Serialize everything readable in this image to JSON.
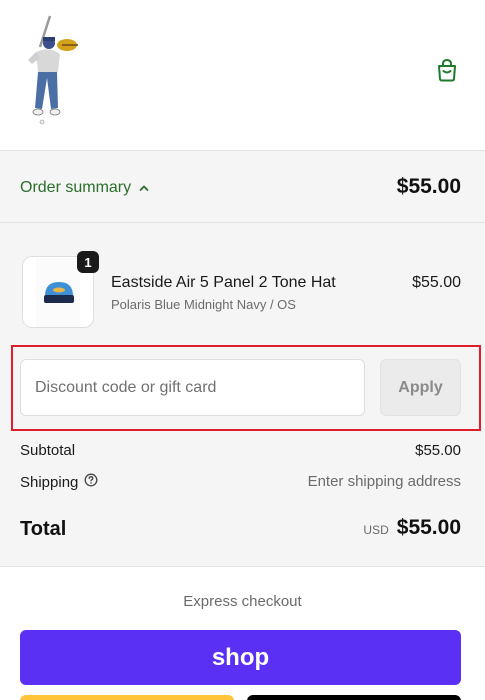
{
  "header": {
    "logo_icon": "golfer-logo-icon",
    "cart_icon": "shopping-bag-icon"
  },
  "order_summary": {
    "toggle_label": "Order summary",
    "toggle_icon": "chevron-up-icon",
    "total": "$55.00"
  },
  "line_item": {
    "quantity": "1",
    "name": "Eastside Air 5 Panel 2 Tone Hat",
    "variant": "Polaris Blue Midnight Navy / OS",
    "price": "$55.00"
  },
  "discount": {
    "placeholder": "Discount code or gift card",
    "value": "",
    "apply_label": "Apply"
  },
  "totals": {
    "subtotal_label": "Subtotal",
    "subtotal_value": "$55.00",
    "shipping_label": "Shipping",
    "shipping_icon": "help-circle-icon",
    "shipping_value": "Enter shipping address",
    "total_label": "Total",
    "currency": "USD",
    "total_value": "$55.00"
  },
  "express": {
    "label": "Express checkout",
    "shop_label": "shop"
  },
  "colors": {
    "accent_green": "#2b6e2b",
    "shop_purple": "#5a31f4",
    "highlight_red": "#e01e2b"
  }
}
